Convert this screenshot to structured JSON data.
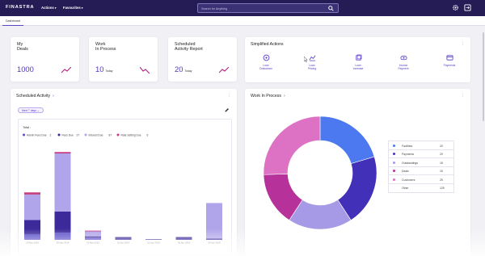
{
  "app": {
    "brand": "FINASTRA"
  },
  "nav": [
    {
      "label": "Actions"
    },
    {
      "label": "Favourites"
    }
  ],
  "search": {
    "placeholder": "Search for Anything"
  },
  "tabs": [
    {
      "label": "Dashboard"
    }
  ],
  "kpis": [
    {
      "title": "My\nDeals",
      "value": "1000",
      "sub": ""
    },
    {
      "title": "Work\nIn Process",
      "value": "10",
      "sub": "Today"
    },
    {
      "title": "Scheduled\nActivity Report",
      "value": "20",
      "sub": "Today"
    }
  ],
  "simplified_actions": {
    "title": "Simplified Actions",
    "items": [
      {
        "label": "Loan\nDrawdown",
        "icon": "drawdown-icon"
      },
      {
        "label": "Loan\nPricing",
        "icon": "pricing-icon"
      },
      {
        "label": "Loan\nIncrease",
        "icon": "increase-icon"
      },
      {
        "label": "Invoice\nPayment",
        "icon": "invoice-icon"
      },
      {
        "label": "Payments",
        "icon": "payment-card-icon"
      }
    ]
  },
  "scheduled_activity": {
    "title": "Scheduled Activity",
    "filter": "Next 7 days",
    "total_label": "Total :",
    "legend": [
      {
        "name": "Admin Fees Due",
        "count": "2",
        "color": "#5b4fc8"
      },
      {
        "name": "Fees Due",
        "count": "27",
        "color": "#3c2a9a"
      },
      {
        "name": "Interest Due",
        "count": "87",
        "color": "#b0a4ea"
      },
      {
        "name": "Rate Setting Due",
        "count": "6",
        "color": "#c83c7e"
      }
    ],
    "x_labels": [
      "29 Mar 2019",
      "30 Mar 2019",
      "31 Mar 2019",
      "01 Apr 2019",
      "02 Apr 2019",
      "03 Apr 2019",
      "04 Apr 2019"
    ]
  },
  "work_in_process": {
    "title": "Work In Process",
    "rows": [
      {
        "name": "Facilities",
        "value": "20",
        "color": "#4d79f0"
      },
      {
        "name": "Payments",
        "value": "20",
        "color": "#4330b8"
      },
      {
        "name": "Outstandings",
        "value": "18",
        "color": "#a69ae6"
      },
      {
        "name": "Deals",
        "value": "15",
        "color": "#b6329a"
      },
      {
        "name": "Customers",
        "value": "25",
        "color": "#dd71c4"
      },
      {
        "name": "Other",
        "value": "125",
        "color": "#ffffff"
      }
    ]
  },
  "colors": {
    "topbar": "#261c55",
    "accent": "#5535c4",
    "trend": "#b0257e"
  },
  "chart_data": [
    {
      "type": "bar",
      "stacked": true,
      "categories": [
        "29 Mar 2019",
        "30 Mar 2019",
        "31 Mar 2019",
        "01 Apr 2019",
        "02 Apr 2019",
        "03 Apr 2019",
        "04 Apr 2019"
      ],
      "series": [
        {
          "name": "Admin Fees Due",
          "values": [
            8,
            10,
            3,
            0,
            0,
            0,
            0
          ]
        },
        {
          "name": "Fees Due",
          "values": [
            20,
            30,
            2,
            4,
            1,
            4,
            2
          ]
        },
        {
          "name": "Interest Due",
          "values": [
            36,
            82,
            7,
            0,
            0,
            0,
            50
          ]
        },
        {
          "name": "Rate Setting Due",
          "values": [
            3,
            2,
            1,
            0,
            0,
            0,
            0
          ]
        }
      ]
    },
    {
      "type": "pie",
      "donut": true,
      "categories": [
        "Facilities",
        "Payments",
        "Outstandings",
        "Deals",
        "Customers"
      ],
      "values": [
        20,
        20,
        18,
        15,
        25
      ]
    }
  ]
}
